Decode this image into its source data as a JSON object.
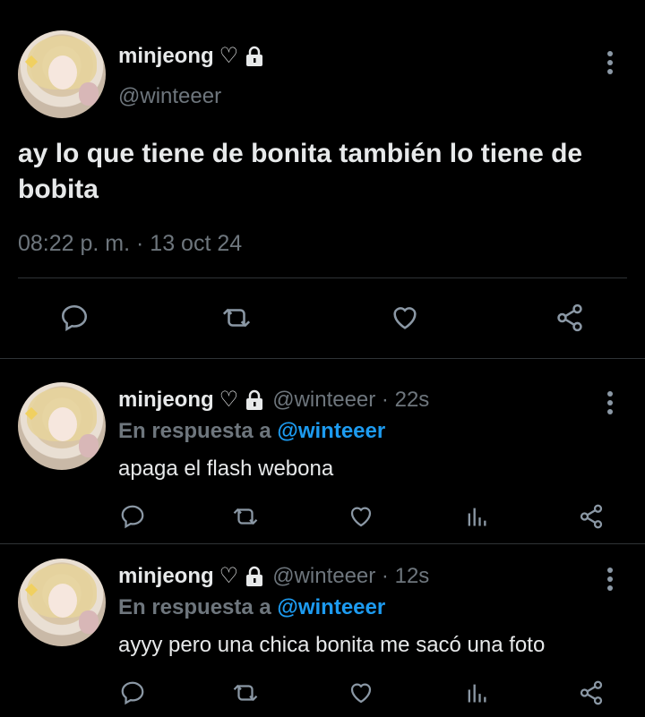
{
  "main_tweet": {
    "author_name": "minjeong",
    "heart_symbol": "♡",
    "handle": "@winteeer",
    "text": "ay lo que tiene de bonita también lo tiene de bobita",
    "timestamp": "08:22 p. m. · 13 oct 24"
  },
  "replies": [
    {
      "author_name": "minjeong",
      "heart_symbol": "♡",
      "handle_time": "@winteeer · 22s",
      "reply_prefix": "En respuesta a",
      "reply_to": "@winteeer",
      "text": "apaga el flash webona"
    },
    {
      "author_name": "minjeong",
      "heart_symbol": "♡",
      "handle_time": "@winteeer · 12s",
      "reply_prefix": "En respuesta a",
      "reply_to": "@winteeer",
      "text": "ayyy pero una chica bonita me sacó una foto"
    }
  ],
  "icons": [
    "comment-icon",
    "retweet-icon",
    "like-icon",
    "share-icon",
    "analytics-icon",
    "lock-icon",
    "more-icon"
  ],
  "colors": {
    "background": "#000000",
    "text": "#e7e9ea",
    "muted": "#6e767d",
    "link": "#1d9bf0",
    "divider": "#2f3336"
  }
}
